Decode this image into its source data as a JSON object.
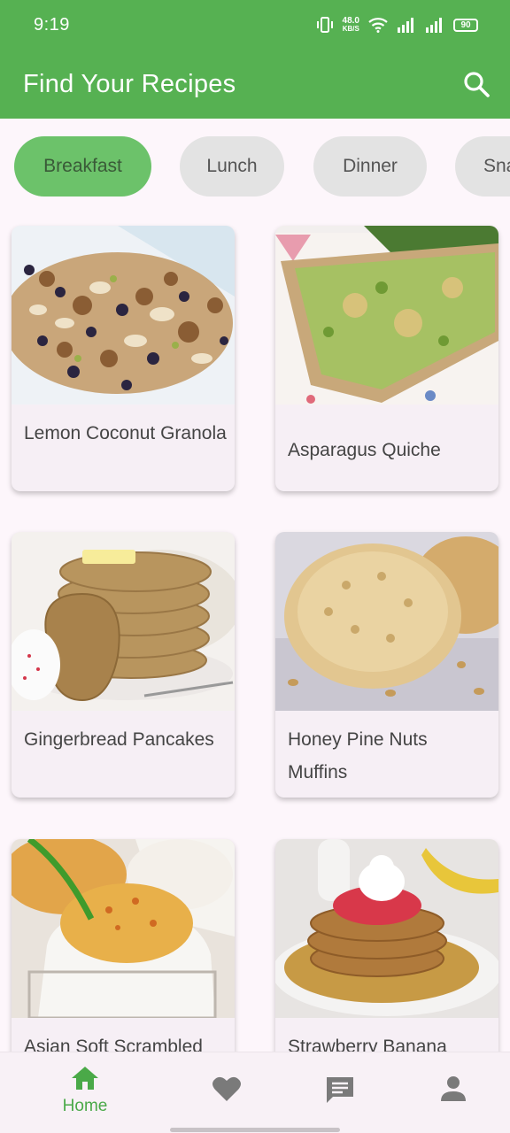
{
  "status_bar": {
    "time": "9:19",
    "net_speed_value": "48.0",
    "net_speed_unit": "KB/S",
    "battery": "90"
  },
  "app_bar": {
    "title": "Find Your Recipes",
    "search_icon": "search-icon"
  },
  "categories": [
    {
      "label": "Breakfast",
      "active": true
    },
    {
      "label": "Lunch",
      "active": false
    },
    {
      "label": "Dinner",
      "active": false
    },
    {
      "label": "Snacks",
      "active": false
    }
  ],
  "recipes": [
    {
      "name": "Lemon Coconut Granola"
    },
    {
      "name": "Asparagus Quiche"
    },
    {
      "name": "Gingerbread Pancakes"
    },
    {
      "name": "Honey Pine Nuts Muffins"
    },
    {
      "name": "Asian Soft Scrambled"
    },
    {
      "name": "Strawberry Banana"
    }
  ],
  "bottom_nav": {
    "items": [
      {
        "label": "Home",
        "icon": "home-icon",
        "active": true
      },
      {
        "label": "",
        "icon": "heart-icon",
        "active": false
      },
      {
        "label": "",
        "icon": "chat-icon",
        "active": false
      },
      {
        "label": "",
        "icon": "person-icon",
        "active": false
      }
    ]
  },
  "colors": {
    "primary": "#56b152",
    "chip_active": "#6cc26a",
    "chip_inactive": "#e3e3e3",
    "nav_active": "#4aa948",
    "nav_inactive": "#7a7a7a"
  }
}
